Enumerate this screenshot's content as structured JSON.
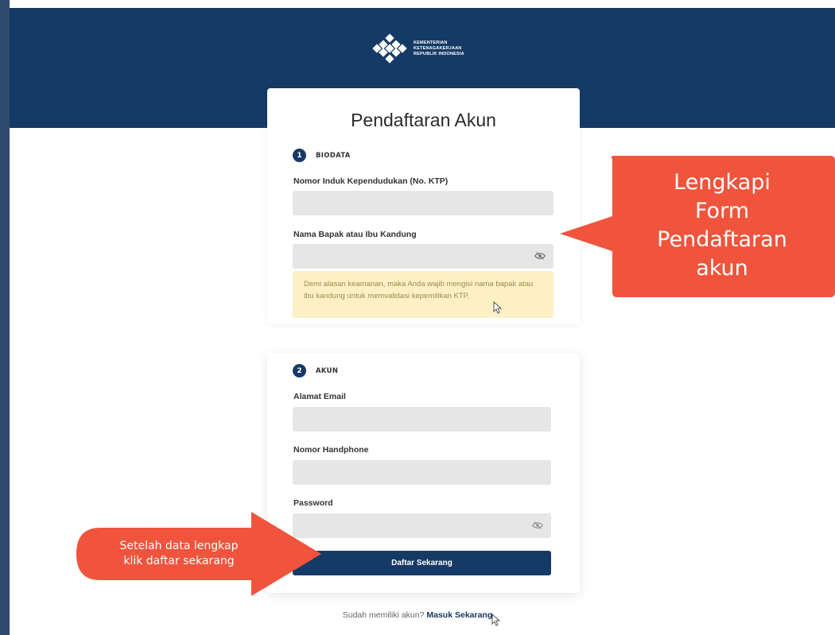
{
  "header": {
    "logo_lines": [
      "KEMENTERIAN",
      "KETENAGAKERJAAN",
      "REPUBLIK INDONESIA"
    ],
    "background_color": "#163a66"
  },
  "form": {
    "title": "Pendaftaran Akun",
    "section1": {
      "number": "1",
      "label": "BIODATA"
    },
    "ktp_label": "Nomor Induk Kependudukan (No. KTP)",
    "ktp_value": "",
    "parent_label": "Nama Bapak atau Ibu Kandung",
    "parent_value": "",
    "notice": "Demi alasan keamanan, maka Anda wajib mengisi nama bapak atau ibu kandung untuk memvalidasi kepemilikan KTP.",
    "section2": {
      "number": "2",
      "label": "AKUN"
    },
    "email_label": "Alamat Email",
    "email_value": "",
    "phone_label": "Nomor Handphone",
    "phone_value": "",
    "password_label": "Password",
    "password_value": "",
    "submit_label": "Daftar Sekarang"
  },
  "footer": {
    "prompt": "Sudah memiliki akun?",
    "login_link": "Masuk Sekarang"
  },
  "callouts": {
    "top": [
      "Lengkapi",
      "Form",
      "Pendaftaran",
      "akun"
    ],
    "bottom": [
      "Setelah data lengkap",
      "klik daftar sekarang"
    ],
    "color": "#f0543c"
  },
  "icons": {
    "password_toggle": "eye-off-icon",
    "cursor": "mouse-pointer-icon",
    "logo": "kemnaker-logo-icon"
  }
}
